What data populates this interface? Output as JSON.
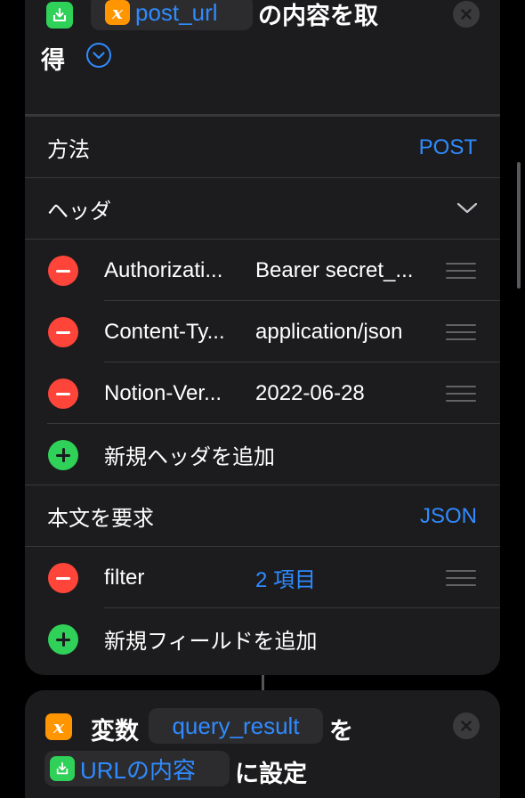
{
  "action": {
    "variable": "post_url",
    "title_line1": "の内容を取",
    "title_line2": "得",
    "method_label": "方法",
    "method_value": "POST",
    "headers_label": "ヘッダ",
    "headers": [
      {
        "key": "Authorizati...",
        "value": "Bearer secret_..."
      },
      {
        "key": "Content-Ty...",
        "value": "application/json"
      },
      {
        "key": "Notion-Ver...",
        "value": "2022-06-28"
      }
    ],
    "add_header_label": "新規ヘッダを追加",
    "body_label": "本文を要求",
    "body_value": "JSON",
    "fields": [
      {
        "key": "filter",
        "value": "2 項目"
      }
    ],
    "add_field_label": "新規フィールドを追加"
  },
  "set_variable": {
    "prefix": "変数",
    "variable": "query_result",
    "particle": "を",
    "source": "URLの内容",
    "suffix": "に設定"
  },
  "colors": {
    "accent": "#2f8bff",
    "card": "#1c1c1e",
    "delete": "#ff453a",
    "add": "#30d158",
    "variable_badge": "#ff9500"
  }
}
